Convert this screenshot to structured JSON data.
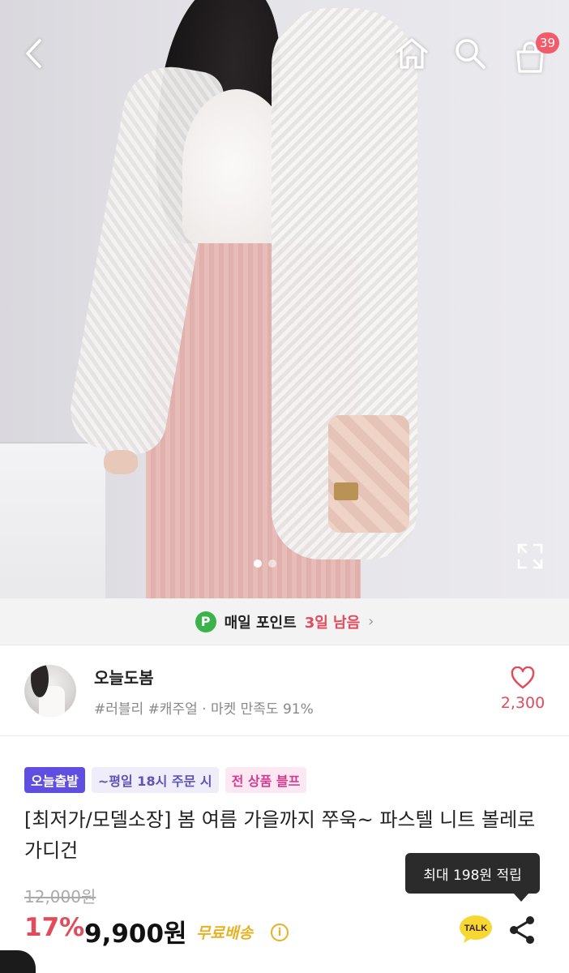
{
  "header": {
    "back_icon": "chevron-left-icon",
    "home_icon": "home-icon",
    "search_icon": "search-icon",
    "cart_icon": "shopping-bag-icon",
    "cart_count": "39"
  },
  "gallery": {
    "image_alt": "product-photo",
    "total_dots": 2,
    "active_dot": 1,
    "expand_icon": "expand-icon"
  },
  "points": {
    "icon_letter": "P",
    "label": "매일 포인트",
    "days_left": "3일 남음",
    "chevron": "›"
  },
  "store": {
    "name": "오늘도봄",
    "tags": "#러블리 #캐주얼 · 마켓 만족도 91%",
    "like_count": "2,300"
  },
  "product": {
    "badges": [
      "오늘출발",
      "~평일 18시 주문 시",
      "전 상품 블프"
    ],
    "title": "[최저가/모델소장] 봄 여름 가을까지 쭈욱~ 파스텔 니트 볼레로 가디건",
    "tooltip": "최대 198원 적립",
    "original_price": "12,000원",
    "discount": "17%",
    "price": "9,900원",
    "shipping": "무료배송",
    "info_icon": "i",
    "talk_label": "TALK"
  },
  "colors": {
    "accent_red": "#e24b5b",
    "point_green": "#3bb34a",
    "badge_purple": "#5f4ee0",
    "shipping_yellow": "#e5b224",
    "kakao_yellow": "#f7d731"
  }
}
